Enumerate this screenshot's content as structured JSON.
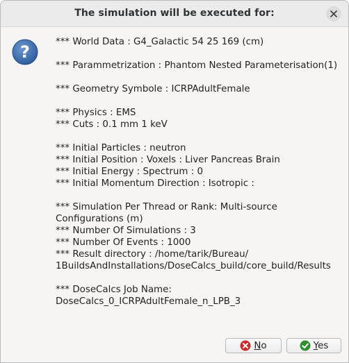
{
  "dialog": {
    "title": "The simulation will be executed for:",
    "close_icon": "close-icon",
    "message_icon": "question-icon"
  },
  "message_lines": [
    "*** World Data : G4_Galactic 54 25 169 (cm)",
    "",
    "*** Parammetrization : Phantom Nested Parameterisation(1)",
    "",
    "*** Geometry Symbole : ICRPAdultFemale",
    "",
    "*** Physics : EMS",
    "*** Cuts : 0.1 mm 1 keV",
    "",
    "*** Initial Particles : neutron",
    "*** Initial Position : Voxels : Liver Pancreas Brain",
    "*** Initial Energy : Spectrum : 0",
    "*** Initial Momentum Direction : Isotropic :",
    "",
    "*** Simulation Per Thread or Rank: Multi-source",
    "Configurations (m)",
    "*** Number Of Simulations : 3",
    "*** Number Of Events : 1000",
    "*** Result directory : /home/tarik/Bureau/",
    "1BuildsAndInstallations/DoseCalcs_build/core_build/Results",
    "",
    "*** DoseCalcs Job Name:",
    "DoseCalcs_0_ICRPAdultFemale_n_LPB_3"
  ],
  "buttons": {
    "no": {
      "mnemonic": "N",
      "rest": "o",
      "icon": "cancel-icon",
      "color": "#cc2a2a"
    },
    "yes": {
      "mnemonic": "Y",
      "rest": "es",
      "icon": "check-icon",
      "color": "#2f8f2f"
    }
  },
  "colors": {
    "icon_blue": "#3465a4",
    "background": "#f6f5f4",
    "titlebar": "#ebebeb"
  }
}
